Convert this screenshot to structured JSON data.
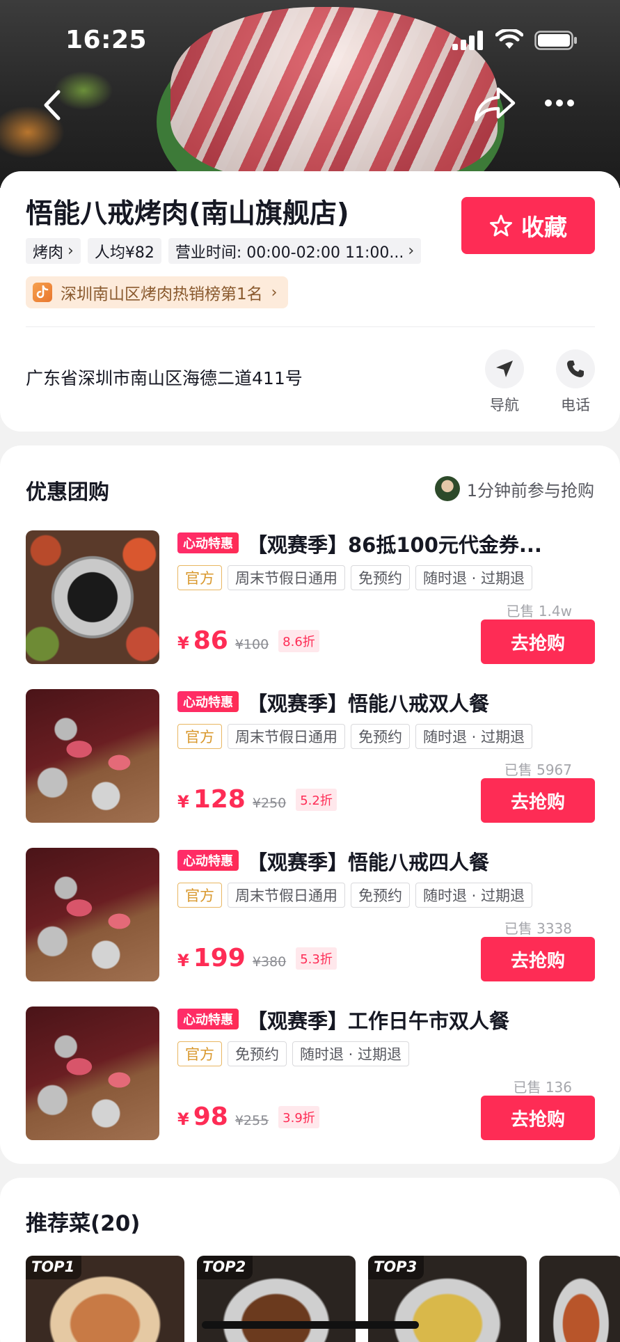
{
  "status_bar": {
    "time": "16:25"
  },
  "shop": {
    "title": "悟能八戒烤肉(南山旗舰店)",
    "favorite_label": "收藏",
    "category": "烤肉",
    "avg_price": "人均¥82",
    "hours": "营业时间: 00:00-02:00 11:00...",
    "rank": "深圳南山区烤肉热销榜第1名",
    "address": "广东省深圳市南山区海德二道411号",
    "nav_label": "导航",
    "phone_label": "电话"
  },
  "deals_section": {
    "title": "优惠团购",
    "recent_activity": "1分钟前参与抢购",
    "items": [
      {
        "badge": "心动特惠",
        "title": "【观赛季】86抵100元代金券...",
        "chips": [
          "官方",
          "周末节假日通用",
          "免预约",
          "随时退 · 过期退"
        ],
        "sold": "已售 1.4w",
        "currency": "¥",
        "price": "86",
        "original_price": "¥100",
        "discount": "8.6折",
        "buy_label": "去抢购"
      },
      {
        "badge": "心动特惠",
        "title": "【观赛季】悟能八戒双人餐",
        "chips": [
          "官方",
          "周末节假日通用",
          "免预约",
          "随时退 · 过期退"
        ],
        "sold": "已售 5967",
        "currency": "¥",
        "price": "128",
        "original_price": "¥250",
        "discount": "5.2折",
        "buy_label": "去抢购"
      },
      {
        "badge": "心动特惠",
        "title": "【观赛季】悟能八戒四人餐",
        "chips": [
          "官方",
          "周末节假日通用",
          "免预约",
          "随时退 · 过期退"
        ],
        "sold": "已售 3338",
        "currency": "¥",
        "price": "199",
        "original_price": "¥380",
        "discount": "5.3折",
        "buy_label": "去抢购"
      },
      {
        "badge": "心动特惠",
        "title": "【观赛季】工作日午市双人餐",
        "chips": [
          "官方",
          "免预约",
          "随时退 · 过期退"
        ],
        "sold": "已售 136",
        "currency": "¥",
        "price": "98",
        "original_price": "¥255",
        "discount": "3.9折",
        "buy_label": "去抢购"
      }
    ]
  },
  "recommended": {
    "title": "推荐菜(20)",
    "badges": [
      "TOP1",
      "TOP2",
      "TOP3"
    ]
  },
  "colors": {
    "accent": "#fe2c55",
    "official_chip": "#d9982d",
    "rank_tag_bg": "#fdebdb"
  },
  "icons": [
    "back-icon",
    "share-icon",
    "more-icon",
    "star-icon",
    "douyin-icon",
    "navigation-icon",
    "phone-icon",
    "signal-icon",
    "wifi-icon",
    "battery-icon"
  ]
}
